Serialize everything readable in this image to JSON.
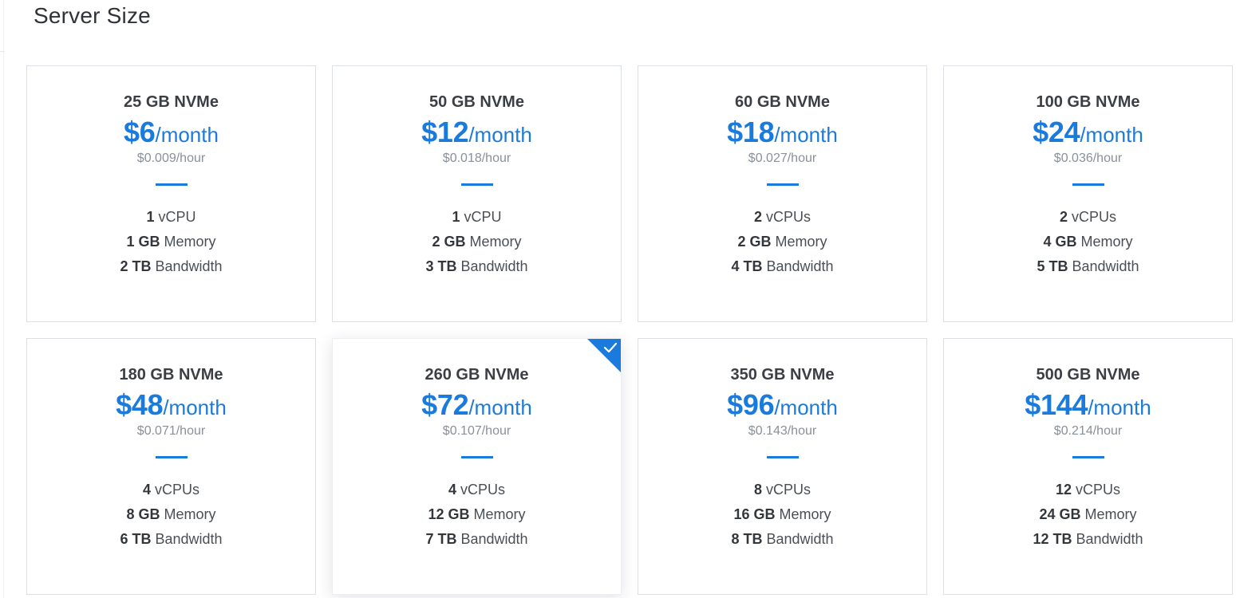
{
  "page": {
    "title": "Server Size"
  },
  "plans": [
    {
      "disk": "25 GB NVMe",
      "price": "$6",
      "period": "/month",
      "hourly": "$0.009/hour",
      "cpu_value": "1",
      "cpu_label": "vCPU",
      "memory_value": "1 GB",
      "memory_label": "Memory",
      "bandwidth_value": "2 TB",
      "bandwidth_label": "Bandwidth",
      "selected": false
    },
    {
      "disk": "50 GB NVMe",
      "price": "$12",
      "period": "/month",
      "hourly": "$0.018/hour",
      "cpu_value": "1",
      "cpu_label": "vCPU",
      "memory_value": "2 GB",
      "memory_label": "Memory",
      "bandwidth_value": "3 TB",
      "bandwidth_label": "Bandwidth",
      "selected": false
    },
    {
      "disk": "60 GB NVMe",
      "price": "$18",
      "period": "/month",
      "hourly": "$0.027/hour",
      "cpu_value": "2",
      "cpu_label": "vCPUs",
      "memory_value": "2 GB",
      "memory_label": "Memory",
      "bandwidth_value": "4 TB",
      "bandwidth_label": "Bandwidth",
      "selected": false
    },
    {
      "disk": "100 GB NVMe",
      "price": "$24",
      "period": "/month",
      "hourly": "$0.036/hour",
      "cpu_value": "2",
      "cpu_label": "vCPUs",
      "memory_value": "4 GB",
      "memory_label": "Memory",
      "bandwidth_value": "5 TB",
      "bandwidth_label": "Bandwidth",
      "selected": false
    },
    {
      "disk": "180 GB NVMe",
      "price": "$48",
      "period": "/month",
      "hourly": "$0.071/hour",
      "cpu_value": "4",
      "cpu_label": "vCPUs",
      "memory_value": "8 GB",
      "memory_label": "Memory",
      "bandwidth_value": "6 TB",
      "bandwidth_label": "Bandwidth",
      "selected": false
    },
    {
      "disk": "260 GB NVMe",
      "price": "$72",
      "period": "/month",
      "hourly": "$0.107/hour",
      "cpu_value": "4",
      "cpu_label": "vCPUs",
      "memory_value": "12 GB",
      "memory_label": "Memory",
      "bandwidth_value": "7 TB",
      "bandwidth_label": "Bandwidth",
      "selected": true
    },
    {
      "disk": "350 GB NVMe",
      "price": "$96",
      "period": "/month",
      "hourly": "$0.143/hour",
      "cpu_value": "8",
      "cpu_label": "vCPUs",
      "memory_value": "16 GB",
      "memory_label": "Memory",
      "bandwidth_value": "8 TB",
      "bandwidth_label": "Bandwidth",
      "selected": false
    },
    {
      "disk": "500 GB NVMe",
      "price": "$144",
      "period": "/month",
      "hourly": "$0.214/hour",
      "cpu_value": "12",
      "cpu_label": "vCPUs",
      "memory_value": "24 GB",
      "memory_label": "Memory",
      "bandwidth_value": "12 TB",
      "bandwidth_label": "Bandwidth",
      "selected": false
    }
  ],
  "colors": {
    "accent": "#1b7bdc",
    "title": "#2f3337",
    "muted": "#8a9099",
    "border": "#dcdfe4"
  },
  "icons": {
    "selected_marker": "checkmark-icon"
  }
}
